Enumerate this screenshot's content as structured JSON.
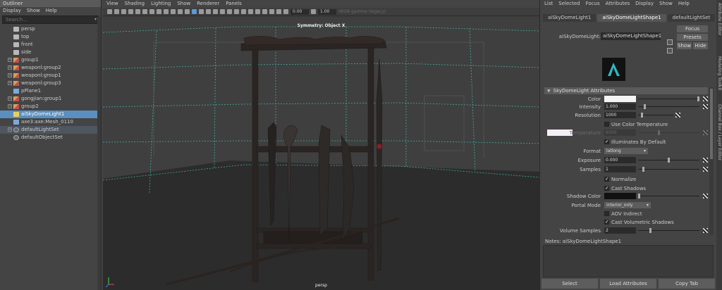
{
  "outliner": {
    "title": "Outliner",
    "menu": [
      "Display",
      "Show",
      "Help"
    ],
    "search_placeholder": "Search...",
    "items": [
      {
        "label": "persp",
        "icon": "camera-icon",
        "expander": false,
        "state": ""
      },
      {
        "label": "top",
        "icon": "camera-icon",
        "expander": false,
        "state": ""
      },
      {
        "label": "front",
        "icon": "camera-icon",
        "expander": false,
        "state": ""
      },
      {
        "label": "side",
        "icon": "camera-icon",
        "expander": false,
        "state": ""
      },
      {
        "label": "group1",
        "icon": "group-icon",
        "expander": true,
        "state": ""
      },
      {
        "label": "weaponl:group2",
        "icon": "group-icon",
        "expander": true,
        "state": ""
      },
      {
        "label": "weaponl:group1",
        "icon": "group-icon",
        "expander": true,
        "state": ""
      },
      {
        "label": "weaponl:group3",
        "icon": "group-icon",
        "expander": true,
        "state": ""
      },
      {
        "label": "pPlane1",
        "icon": "mesh-icon",
        "expander": false,
        "state": ""
      },
      {
        "label": "gongjian:group1",
        "icon": "group-icon",
        "expander": true,
        "state": ""
      },
      {
        "label": "group2",
        "icon": "group-icon",
        "expander": true,
        "state": ""
      },
      {
        "label": "aiSkyDomeLight1",
        "icon": "light-icon",
        "expander": false,
        "state": "selected"
      },
      {
        "label": "axe3:axe:Mesh_0110",
        "icon": "mesh-icon",
        "expander": false,
        "state": ""
      },
      {
        "label": "defaultLightSet",
        "icon": "set-icon",
        "expander": true,
        "state": "lightset"
      },
      {
        "label": "defaultObjectSet",
        "icon": "set-icon",
        "expander": false,
        "state": ""
      }
    ]
  },
  "viewport": {
    "menu": [
      "View",
      "Shading",
      "Lighting",
      "Show",
      "Renderer",
      "Panels"
    ],
    "exposure": "0.00",
    "gamma": "1.00",
    "colorspace": "sRGB gamma (legacy)",
    "symmetry_label": "Symmetry: Object X",
    "camera_label": "persp"
  },
  "attribute_editor": {
    "menu": [
      "List",
      "Selected",
      "Focus",
      "Attributes",
      "Display",
      "Show",
      "Help"
    ],
    "tabs": [
      "aiSkyDomeLight1",
      "aiSkyDomeLightShape1",
      "defaultLightSet"
    ],
    "active_tab": 1,
    "node_label": "aiSkyDomeLight:",
    "node_value": "aiSkyDomeLightShape1",
    "focus_label": "Focus",
    "presets_label": "Presets",
    "show_label": "Show",
    "hide_label": "Hide",
    "section_title": "SkyDomeLight Attributes",
    "attrs": {
      "color_label": "Color",
      "intensity_label": "Intensity",
      "intensity": "1.000",
      "resolution_label": "Resolution",
      "resolution": "1000",
      "use_color_temp_label": "Use Color Temperature",
      "temperature_label": "Temperature",
      "temperature": "6500",
      "illuminates_label": "Illuminates By Default",
      "format_label": "Format",
      "format": "latlong",
      "exposure_label": "Exposure",
      "exposure": "0.000",
      "samples_label": "Samples",
      "samples": "1",
      "normalize_label": "Normalize",
      "cast_shadows_label": "Cast Shadows",
      "shadow_color_label": "Shadow Color",
      "portal_mode_label": "Portal Mode",
      "portal_mode": "interior_only",
      "aov_indirect_label": "AOV Indirect",
      "cast_volumetric_label": "Cast Volumetric Shadows",
      "volume_samples_label": "Volume Samples",
      "volume_samples": "2"
    },
    "notes_label": "Notes:  aiSkyDomeLightShape1",
    "select_button": "Select",
    "load_attributes_button": "Load Attributes",
    "copy_tab_button": "Copy Tab",
    "side_tabs": [
      "Attribute Editor",
      "Modeling Toolkit",
      "Channel Box / Layer Editor"
    ]
  },
  "colors": {
    "selection": "#5a8fbf",
    "grid": "#45c0b0",
    "background": "#444444"
  }
}
